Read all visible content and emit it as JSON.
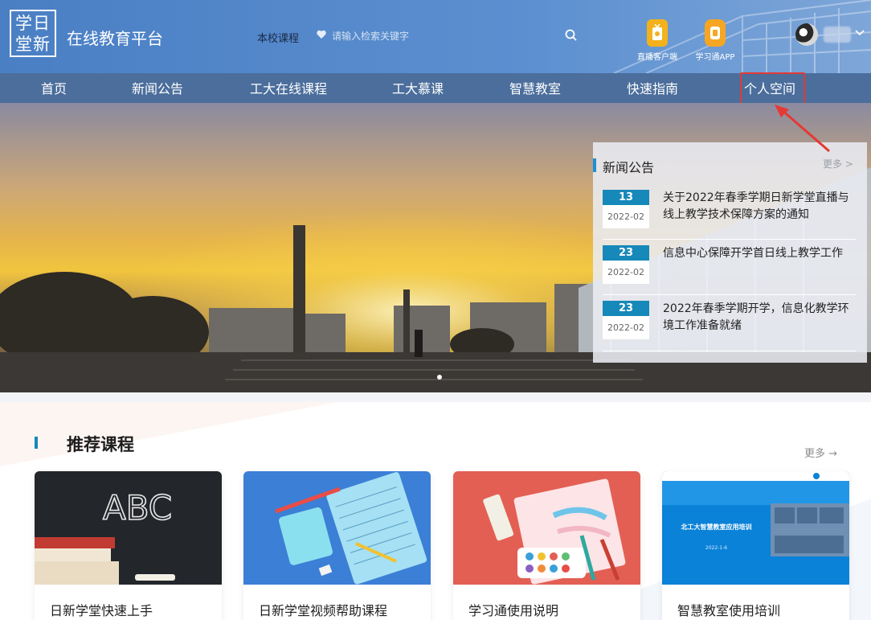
{
  "header": {
    "logo_text": [
      "学日",
      "堂新"
    ],
    "site_name": "在线教育平台",
    "search_scope": "本校课程",
    "search_placeholder": "请输入检索关键字",
    "apps": [
      {
        "label": "直播客户端",
        "icon": "live-client-icon",
        "color": "#f3b21b"
      },
      {
        "label": "学习通APP",
        "icon": "xuexitong-app-icon",
        "color": "#f6a623"
      }
    ]
  },
  "nav": {
    "items": [
      "首页",
      "新闻公告",
      "工大在线课程",
      "工大慕课",
      "智慧教室",
      "快速指南",
      "个人空间"
    ],
    "highlighted": "个人空间",
    "highlight_color": "#e53935"
  },
  "news": {
    "title": "新闻公告",
    "more": "更多 >",
    "items": [
      {
        "day": "13",
        "month": "2022-02",
        "text": "关于2022年春季学期日新学堂直播与线上教学技术保障方案的通知"
      },
      {
        "day": "23",
        "month": "2022-02",
        "text": "信息中心保障开学首日线上教学工作"
      },
      {
        "day": "23",
        "month": "2022-02",
        "text": "2022年春季学期开学，信息化教学环境工作准备就绪"
      }
    ]
  },
  "recommend": {
    "title": "推荐课程",
    "more": "更多 →",
    "cards": [
      {
        "title": "日新学堂快速上手",
        "image": "chalkboard-abc"
      },
      {
        "title": "日新学堂视频帮助课程",
        "image": "stationery-illustration"
      },
      {
        "title": "学习通使用说明",
        "image": "paint-palette-illustration"
      },
      {
        "title": "智慧教室使用培训",
        "image": "smart-classroom-cover",
        "cover_title": "北工大智慧教室应用培训",
        "cover_date": "2022-1-6"
      }
    ]
  },
  "colors": {
    "header": "#4a7fc4",
    "nav": "#4b6e9c",
    "accent": "#1688b9"
  }
}
